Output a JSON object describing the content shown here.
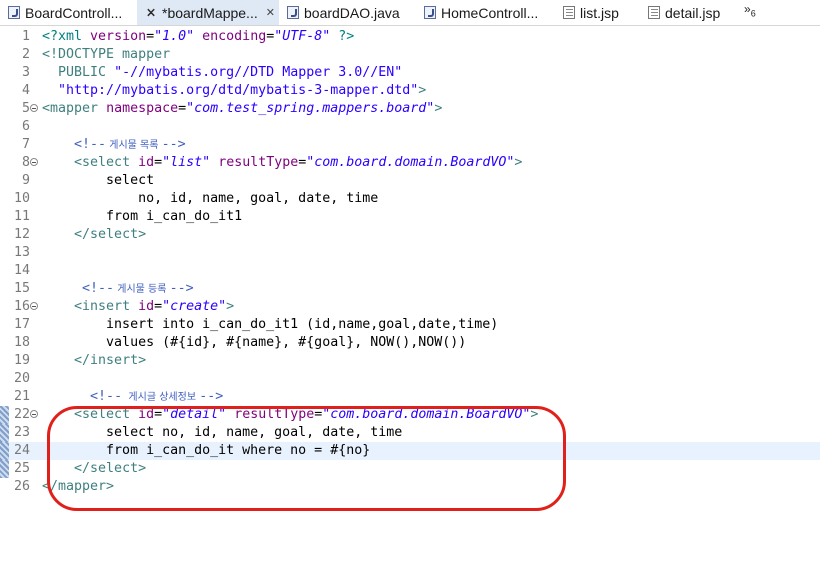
{
  "tabs": [
    {
      "label": "BoardControll...",
      "icon": "java-file-icon",
      "active": false,
      "closable": false
    },
    {
      "label": "*boardMappe...",
      "icon": "xml-file-icon",
      "active": true,
      "closable": true
    },
    {
      "label": "boardDAO.java",
      "icon": "java-file-icon",
      "active": false,
      "closable": false
    },
    {
      "label": "HomeControll...",
      "icon": "java-file-icon",
      "active": false,
      "closable": false
    },
    {
      "label": "list.jsp",
      "icon": "jsp-file-icon",
      "active": false,
      "closable": false
    },
    {
      "label": "detail.jsp",
      "icon": "jsp-file-icon",
      "active": false,
      "closable": false
    }
  ],
  "overflow": {
    "label": "»",
    "count": "6"
  },
  "editor": {
    "current_line": 24,
    "lines": [
      {
        "n": "1",
        "code": "<?xml version=\"1.0\" encoding=\"UTF-8\" ?>"
      },
      {
        "n": "2",
        "code": "<!DOCTYPE mapper"
      },
      {
        "n": "3",
        "code": "  PUBLIC \"-//mybatis.org//DTD Mapper 3.0//EN\""
      },
      {
        "n": "4",
        "code": "  \"http://mybatis.org/dtd/mybatis-3-mapper.dtd\">"
      },
      {
        "n": "5",
        "code": "<mapper namespace=\"com.test_spring.mappers.board\">"
      },
      {
        "n": "6",
        "code": ""
      },
      {
        "n": "7",
        "code": "    <!-- 게시물 목록 -->"
      },
      {
        "n": "8",
        "code": "    <select id=\"list\" resultType=\"com.board.domain.BoardVO\">"
      },
      {
        "n": "9",
        "code": "        select"
      },
      {
        "n": "10",
        "code": "            no, id, name, goal, date, time"
      },
      {
        "n": "11",
        "code": "        from i_can_do_it1"
      },
      {
        "n": "12",
        "code": "    </select>"
      },
      {
        "n": "13",
        "code": ""
      },
      {
        "n": "14",
        "code": ""
      },
      {
        "n": "15",
        "code": "     <!-- 게시물 등록 -->"
      },
      {
        "n": "16",
        "code": "    <insert id=\"create\">"
      },
      {
        "n": "17",
        "code": "        insert into i_can_do_it1 (id,name,goal,date,time)"
      },
      {
        "n": "18",
        "code": "        values (#{id}, #{name}, #{goal}, NOW(),NOW())"
      },
      {
        "n": "19",
        "code": "    </insert>"
      },
      {
        "n": "20",
        "code": ""
      },
      {
        "n": "21",
        "code": "      <!--  게시글 상세정보 -->"
      },
      {
        "n": "22",
        "code": "    <select id=\"detail\" resultType=\"com.board.domain.BoardVO\">"
      },
      {
        "n": "23",
        "code": "        select no, id, name, goal, date, time"
      },
      {
        "n": "24",
        "code": "        from i_can_do_it where no = #{no}"
      },
      {
        "n": "25",
        "code": "    </select>"
      },
      {
        "n": "26",
        "code": "</mapper>"
      }
    ],
    "fold_lines": [
      5,
      8,
      16,
      22
    ],
    "marked_lines": [
      22,
      23,
      24,
      25
    ]
  },
  "colors": {
    "tag": "#3f7f7f",
    "attribute": "#7f007f",
    "value": "#2a00ff",
    "comment": "#3f5fbf",
    "annotation": "#e0201b",
    "current_line": "#e8f2fe"
  }
}
